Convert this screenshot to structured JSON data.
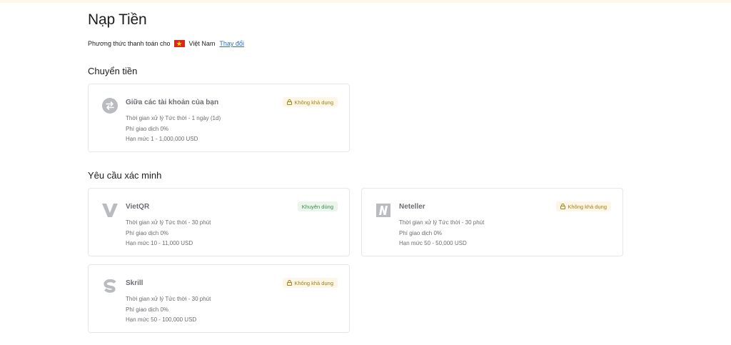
{
  "page": {
    "title": "Nạp Tiền",
    "payment_methods_for": "Phương thức thanh toán cho",
    "country": "Việt Nam",
    "change_link": "Thay đổi",
    "flag_color": "#da251d"
  },
  "sections": [
    {
      "title": "Chuyển tiền",
      "cards": [
        {
          "name": "Giữa các tài khoản của bạn",
          "badge": "Không khả dụng",
          "badge_type": "unavailable",
          "icon": "transfer-arrows-icon",
          "processing": "Thời gian xử lý Tức thời - 1 ngày (1d)",
          "fee": "Phí giao dịch 0%",
          "limit": "Hạn mức 1 - 1,000,000 USD"
        }
      ]
    },
    {
      "title": "Yêu cầu xác minh",
      "cards": [
        {
          "name": "VietQR",
          "badge": "Khuyên dùng",
          "badge_type": "recommended",
          "icon": "vietqr-logo-icon",
          "processing": "Thời gian xử lý Tức thời - 30 phút",
          "fee": "Phí giao dịch 0%",
          "limit": "Hạn mức 10 - 11,000 USD"
        },
        {
          "name": "Neteller",
          "badge": "Không khả dụng",
          "badge_type": "unavailable",
          "icon": "neteller-logo-icon",
          "processing": "Thời gian xử lý Tức thời - 30 phút",
          "fee": "Phí giao dịch 0%",
          "limit": "Hạn mức 50 - 50,000 USD"
        },
        {
          "name": "Skrill",
          "badge": "Không khả dụng",
          "badge_type": "unavailable",
          "icon": "skrill-logo-icon",
          "processing": "Thời gian xử lý Tức thời - 30 phút",
          "fee": "Phí giao dịch 0%",
          "limit": "Hạn mức 50 - 100,000 USD"
        }
      ]
    }
  ],
  "colors": {
    "unavailable_badge_text": "#a5801a",
    "recommended_badge_text": "#3c8a4f",
    "link": "#2a6ec9"
  }
}
